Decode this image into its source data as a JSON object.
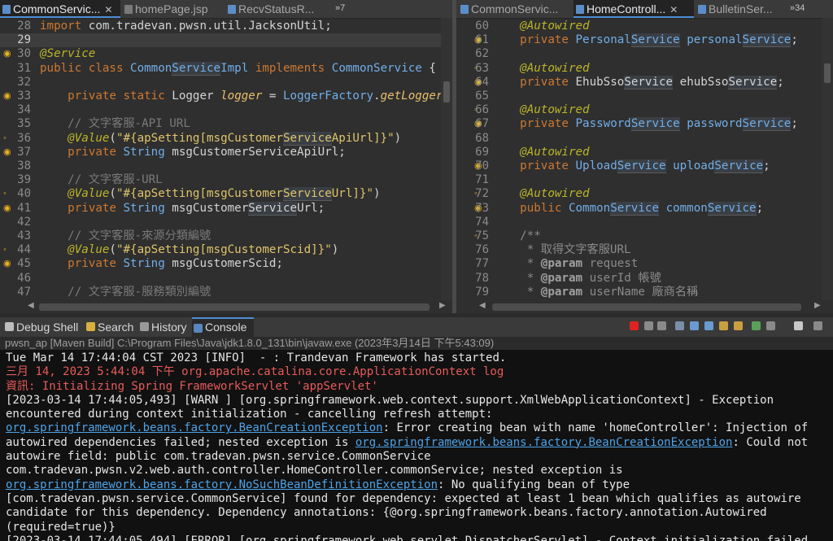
{
  "left_editor": {
    "tabs": [
      {
        "label": "CommonServic...",
        "icon": "java-file-icon",
        "active": true
      },
      {
        "label": "homePage.jsp",
        "icon": "jsp-file-icon",
        "active": false
      },
      {
        "label": "RecvStatusR...",
        "icon": "java-file-icon",
        "active": false
      }
    ],
    "overflow": "»7",
    "lines": [
      {
        "n": "28",
        "mark": "",
        "html": "<span class='kw'>import</span><span class='pln'> com.tradevan.pwsn.util.JacksonUtil;</span>"
      },
      {
        "n": "29",
        "mark": "",
        "html": "",
        "current": true
      },
      {
        "n": "30",
        "mark": "◉",
        "html": "<span class='ann'>@Service</span>"
      },
      {
        "n": "31",
        "mark": "",
        "html": "<span class='kw'>public class</span><span class='pln'> </span><span class='typ'>Common<span class='hl'>Service</span>Impl</span><span class='pln'> </span><span class='kw'>implements</span><span class='pln'> </span><span class='typ'>CommonService</span><span class='pln'> {</span>"
      },
      {
        "n": "32",
        "mark": "",
        "html": ""
      },
      {
        "n": "33",
        "mark": "◉",
        "html": "<span class='pln'>    </span><span class='kw'>private static</span><span class='pln'> Logger </span><span class='fldi'>logger</span><span class='pln'> = </span><span class='typ'>LoggerFactory</span><span class='pln'>.</span><span class='fldi'>getLogger</span><span class='pln'>(</span>"
      },
      {
        "n": "34",
        "mark": "",
        "html": ""
      },
      {
        "n": "35",
        "mark": "",
        "html": "<span class='cmt'>    // 文字客服-API URL</span>"
      },
      {
        "n": "36",
        "mark": "◦",
        "html": "<span class='pln'>    </span><span class='ann'>@Value</span><span class='pln'>(</span><span class='str'>\"#{apSetting[msgCustomer<span class='hl'>Service</span>ApiUrl]}\"</span><span class='pln'>)</span>"
      },
      {
        "n": "37",
        "mark": "◉",
        "html": "<span class='pln'>    </span><span class='kw'>private</span><span class='pln'> </span><span class='typ'>String</span><span class='pln'> msgCustomerServiceApiUrl;</span>"
      },
      {
        "n": "38",
        "mark": "",
        "html": ""
      },
      {
        "n": "39",
        "mark": "",
        "html": "<span class='cmt'>    // 文字客服-URL</span>"
      },
      {
        "n": "40",
        "mark": "◦",
        "html": "<span class='pln'>    </span><span class='ann'>@Value</span><span class='pln'>(</span><span class='str'>\"#{apSetting[msgCustomer<span class='hl'>Service</span>Url]}\"</span><span class='pln'>)</span>"
      },
      {
        "n": "41",
        "mark": "◉",
        "html": "<span class='pln'>    </span><span class='kw'>private</span><span class='pln'> </span><span class='typ'>String</span><span class='pln'> msgCustomer<span class='hl'>Service</span>Url;</span>"
      },
      {
        "n": "42",
        "mark": "",
        "html": ""
      },
      {
        "n": "43",
        "mark": "",
        "html": "<span class='cmt'>    // 文字客服-來源分類編號</span>"
      },
      {
        "n": "44",
        "mark": "◦",
        "html": "<span class='pln'>    </span><span class='ann'>@Value</span><span class='pln'>(</span><span class='str'>\"#{apSetting[msgCustomerScid]}\"</span><span class='pln'>)</span>"
      },
      {
        "n": "45",
        "mark": "◉",
        "html": "<span class='pln'>    </span><span class='kw'>private</span><span class='pln'> </span><span class='typ'>String</span><span class='pln'> msgCustomerScid;</span>"
      },
      {
        "n": "46",
        "mark": "",
        "html": ""
      },
      {
        "n": "47",
        "mark": "",
        "html": "<span class='cmt'>    // 文字客服-服務類別編號</span>"
      }
    ]
  },
  "right_editor": {
    "tabs": [
      {
        "label": "CommonServic...",
        "icon": "java-file-icon",
        "active": false
      },
      {
        "label": "HomeControll...",
        "icon": "java-file-icon",
        "active": true
      },
      {
        "label": "BulletinSer...",
        "icon": "java-file-icon",
        "active": false
      }
    ],
    "overflow": "»34",
    "lines": [
      {
        "n": "60",
        "mark": "",
        "html": "<span class='ann'>    @Autowired</span>"
      },
      {
        "n": "61",
        "mark": "◉",
        "html": "<span class='pln'>    </span><span class='kw'>private</span><span class='pln'> </span><span class='typ'>Personal<span class='hl'>Service</span></span><span class='pln'> </span><span class='typ'>personal<span class='hl'>Service</span></span><span class='pln'>;</span>"
      },
      {
        "n": "62",
        "mark": "",
        "html": ""
      },
      {
        "n": "63",
        "mark": "◦",
        "html": "<span class='ann'>    @Autowired</span>"
      },
      {
        "n": "64",
        "mark": "◉",
        "html": "<span class='pln'>    </span><span class='kw'>private</span><span class='pln'> EhubSso<span class='hl'>Service</span> ehubSso<span class='hl'>Service</span>;</span>"
      },
      {
        "n": "65",
        "mark": "",
        "html": ""
      },
      {
        "n": "66",
        "mark": "◦",
        "html": "<span class='ann'>    @Autowired</span>"
      },
      {
        "n": "67",
        "mark": "◉",
        "html": "<span class='pln'>    </span><span class='kw'>private</span><span class='pln'> </span><span class='typ'>Password<span class='hl'>Service</span></span><span class='pln'> </span><span class='typ'>password<span class='hl'>Service</span></span><span class='pln'>;</span>"
      },
      {
        "n": "68",
        "mark": "",
        "html": ""
      },
      {
        "n": "69",
        "mark": "",
        "html": "<span class='ann'>    @Autowired</span>"
      },
      {
        "n": "70",
        "mark": "◉",
        "html": "<span class='pln'>    </span><span class='kw'>private</span><span class='pln'> </span><span class='typ'>Upload<span class='hl'>Service</span></span><span class='pln'> </span><span class='typ'>upload<span class='hl'>Service</span></span><span class='pln'>;</span>"
      },
      {
        "n": "71",
        "mark": "",
        "html": ""
      },
      {
        "n": "72",
        "mark": "◦",
        "html": "<span class='ann'>    @Autowired</span>"
      },
      {
        "n": "73",
        "mark": "◉",
        "html": "<span class='pln'>    </span><span class='kw'>public</span><span class='pln'> </span><span class='typ'>Common<span class='hl'>Service</span></span><span class='pln'> </span><span class='typ'>common<span class='hl'>Service</span></span><span class='pln'>;</span>"
      },
      {
        "n": "74",
        "mark": "",
        "html": ""
      },
      {
        "n": "75",
        "mark": "◦",
        "html": "<span class='doc'>    /**</span>"
      },
      {
        "n": "76",
        "mark": "",
        "html": "<span class='doc'>     * 取得文字客服URL</span>"
      },
      {
        "n": "77",
        "mark": "",
        "html": "<span class='doc'>     * </span><span class='doctag'>@param</span><span class='doc'> request</span>"
      },
      {
        "n": "78",
        "mark": "",
        "html": "<span class='doc'>     * </span><span class='doctag'>@param</span><span class='doc'> userId 帳號</span>"
      },
      {
        "n": "79",
        "mark": "",
        "html": "<span class='doc'>     * </span><span class='doctag'>@param</span><span class='doc'> userName 廠商名稱</span>"
      }
    ]
  },
  "views": {
    "tabs": [
      {
        "label": "Debug Shell",
        "icon": "debug-shell-icon",
        "color": "#c0c0c0",
        "active": false
      },
      {
        "label": "Search",
        "icon": "search-icon",
        "color": "#d8b040",
        "active": false
      },
      {
        "label": "History",
        "icon": "history-icon",
        "color": "#9a9a9a",
        "active": false
      },
      {
        "label": "Console",
        "icon": "console-icon",
        "color": "#5a86c0",
        "active": true
      }
    ],
    "process_label": "pwsn_ap [Maven Build] C:\\Program Files\\Java\\jdk1.8.0_131\\bin\\javaw.exe  (2023年3月14日 下午5:43:09)"
  },
  "console_lines": [
    {
      "cls": "",
      "html": "Tue Mar 14 17:44:04 CST 2023 [INFO]  - : Trandevan Framework has started."
    },
    {
      "cls": "red",
      "html": "三月 14, 2023 5:44:04 下午 org.apache.catalina.core.ApplicationContext log"
    },
    {
      "cls": "red",
      "html": "資訊: Initializing Spring FrameworkServlet 'appServlet'"
    },
    {
      "cls": "",
      "html": "[2023-03-14 17:44:05,493] [WARN ] [org.springframework.web.context.support.XmlWebApplicationContext] - Exception"
    },
    {
      "cls": "",
      "html": "encountered during context initialization - cancelling refresh attempt:"
    },
    {
      "cls": "",
      "html": "<span class='link'>org.springframework.beans.factory.BeanCreationException</span>: Error creating bean with name 'homeController': Injection of"
    },
    {
      "cls": "",
      "html": "autowired dependencies failed; nested exception is <span class='link'>org.springframework.beans.factory.BeanCreationException</span>: Could not"
    },
    {
      "cls": "",
      "html": "autowire field: public com.tradevan.pwsn.service.CommonService"
    },
    {
      "cls": "",
      "html": "com.tradevan.pwsn.v2.web.auth.controller.HomeController.commonService; nested exception is"
    },
    {
      "cls": "",
      "html": "<span class='link'>org.springframework.beans.factory.NoSuchBeanDefinitionException</span>: No qualifying bean of type"
    },
    {
      "cls": "",
      "html": "[com.tradevan.pwsn.service.CommonService] found for dependency: expected at least 1 bean which qualifies as autowire"
    },
    {
      "cls": "",
      "html": "candidate for this dependency. Dependency annotations: {@org.springframework.beans.factory.annotation.Autowired"
    },
    {
      "cls": "",
      "html": "(required=true)}"
    },
    {
      "cls": "",
      "html": "[2023-03-14 17:44:05,494] [ERROR] [org.springframework.web.servlet.DispatcherServlet] - Context initialization failed"
    }
  ]
}
